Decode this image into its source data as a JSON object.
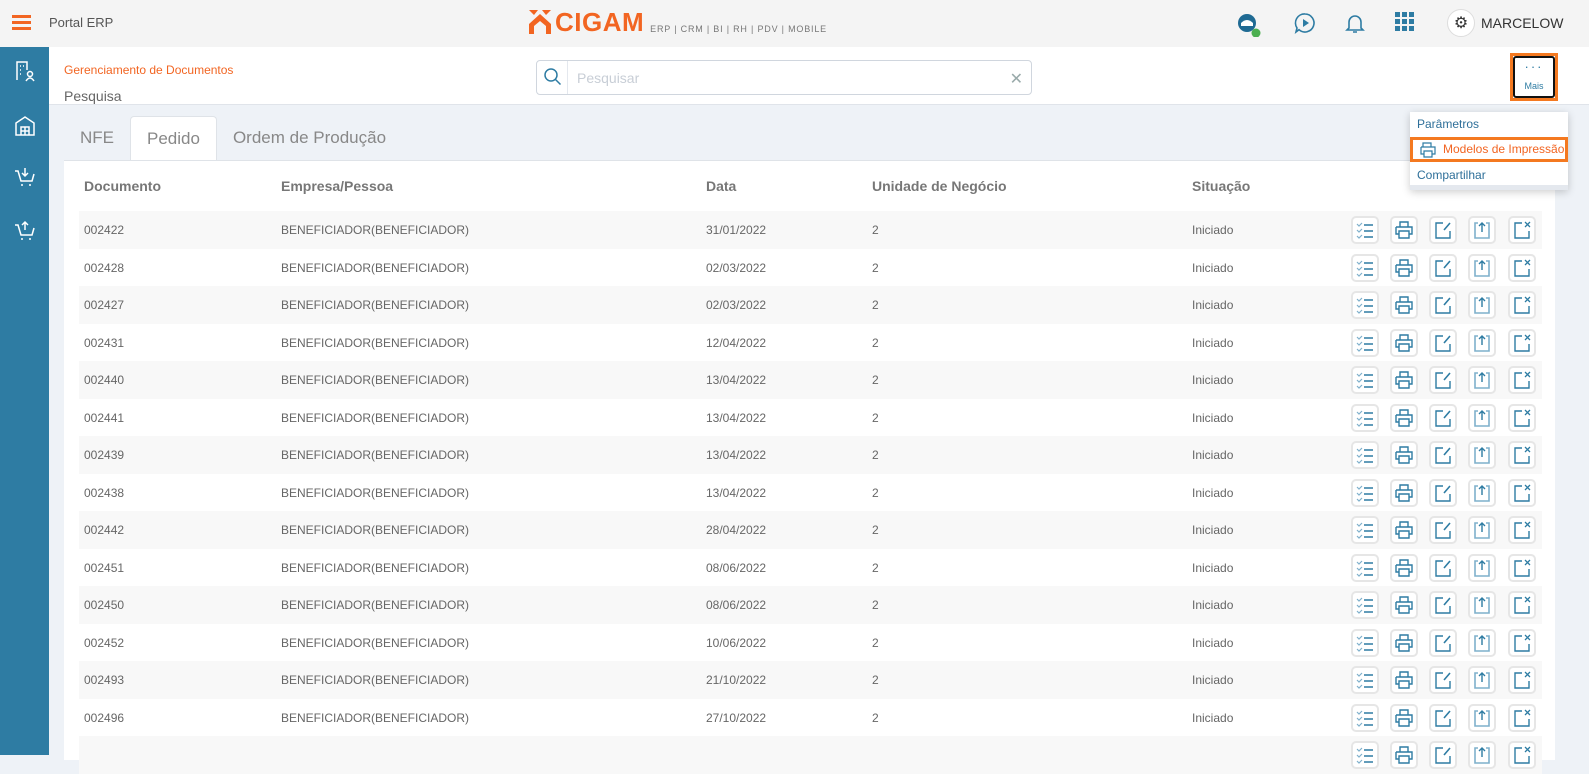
{
  "topbar": {
    "app_title": "Portal ERP",
    "logo_name": "CIGAM",
    "logo_tagline": "ERP | CRM | BI | RH | PDV | MOBILE",
    "user_name": "MARCELOW",
    "online_status_color": "#4caf50"
  },
  "sidebar": {
    "items": [
      {
        "icon": "building-user-icon"
      },
      {
        "icon": "warehouse-icon"
      },
      {
        "icon": "cart-download-icon"
      },
      {
        "icon": "cart-upload-icon"
      }
    ]
  },
  "header": {
    "breadcrumb": "Gerenciamento de Documentos",
    "title": "Pesquisa",
    "search_placeholder": "Pesquisar",
    "search_value": "",
    "more_label": "Mais"
  },
  "menu": {
    "items": [
      {
        "label": "Parâmetros"
      },
      {
        "label": "Modelos de Impressão",
        "icon": "printer-icon",
        "highlighted": true
      },
      {
        "label": "Compartilhar"
      }
    ]
  },
  "tabs": [
    {
      "label": "NFE"
    },
    {
      "label": "Pedido",
      "active": true
    },
    {
      "label": "Ordem de Produção"
    }
  ],
  "table": {
    "columns": [
      "Documento",
      "Empresa/Pessoa",
      "Data",
      "Unidade de Negócio",
      "Situação"
    ],
    "actions": [
      "checklist-icon",
      "printer-icon",
      "edit-icon",
      "upload-icon",
      "cancel-icon"
    ],
    "rows": [
      [
        "002422",
        "BENEFICIADOR(BENEFICIADOR)",
        "31/01/2022",
        "2",
        "Iniciado"
      ],
      [
        "002428",
        "BENEFICIADOR(BENEFICIADOR)",
        "02/03/2022",
        "2",
        "Iniciado"
      ],
      [
        "002427",
        "BENEFICIADOR(BENEFICIADOR)",
        "02/03/2022",
        "2",
        "Iniciado"
      ],
      [
        "002431",
        "BENEFICIADOR(BENEFICIADOR)",
        "12/04/2022",
        "2",
        "Iniciado"
      ],
      [
        "002440",
        "BENEFICIADOR(BENEFICIADOR)",
        "13/04/2022",
        "2",
        "Iniciado"
      ],
      [
        "002441",
        "BENEFICIADOR(BENEFICIADOR)",
        "13/04/2022",
        "2",
        "Iniciado"
      ],
      [
        "002439",
        "BENEFICIADOR(BENEFICIADOR)",
        "13/04/2022",
        "2",
        "Iniciado"
      ],
      [
        "002438",
        "BENEFICIADOR(BENEFICIADOR)",
        "13/04/2022",
        "2",
        "Iniciado"
      ],
      [
        "002442",
        "BENEFICIADOR(BENEFICIADOR)",
        "28/04/2022",
        "2",
        "Iniciado"
      ],
      [
        "002451",
        "BENEFICIADOR(BENEFICIADOR)",
        "08/06/2022",
        "2",
        "Iniciado"
      ],
      [
        "002450",
        "BENEFICIADOR(BENEFICIADOR)",
        "08/06/2022",
        "2",
        "Iniciado"
      ],
      [
        "002452",
        "BENEFICIADOR(BENEFICIADOR)",
        "10/06/2022",
        "2",
        "Iniciado"
      ],
      [
        "002493",
        "BENEFICIADOR(BENEFICIADOR)",
        "21/10/2022",
        "2",
        "Iniciado"
      ],
      [
        "002496",
        "BENEFICIADOR(BENEFICIADOR)",
        "27/10/2022",
        "2",
        "Iniciado"
      ]
    ]
  },
  "colors": {
    "accent": "#f26522",
    "sidebar": "#2e7ca3",
    "icon": "#2e7ca3"
  }
}
